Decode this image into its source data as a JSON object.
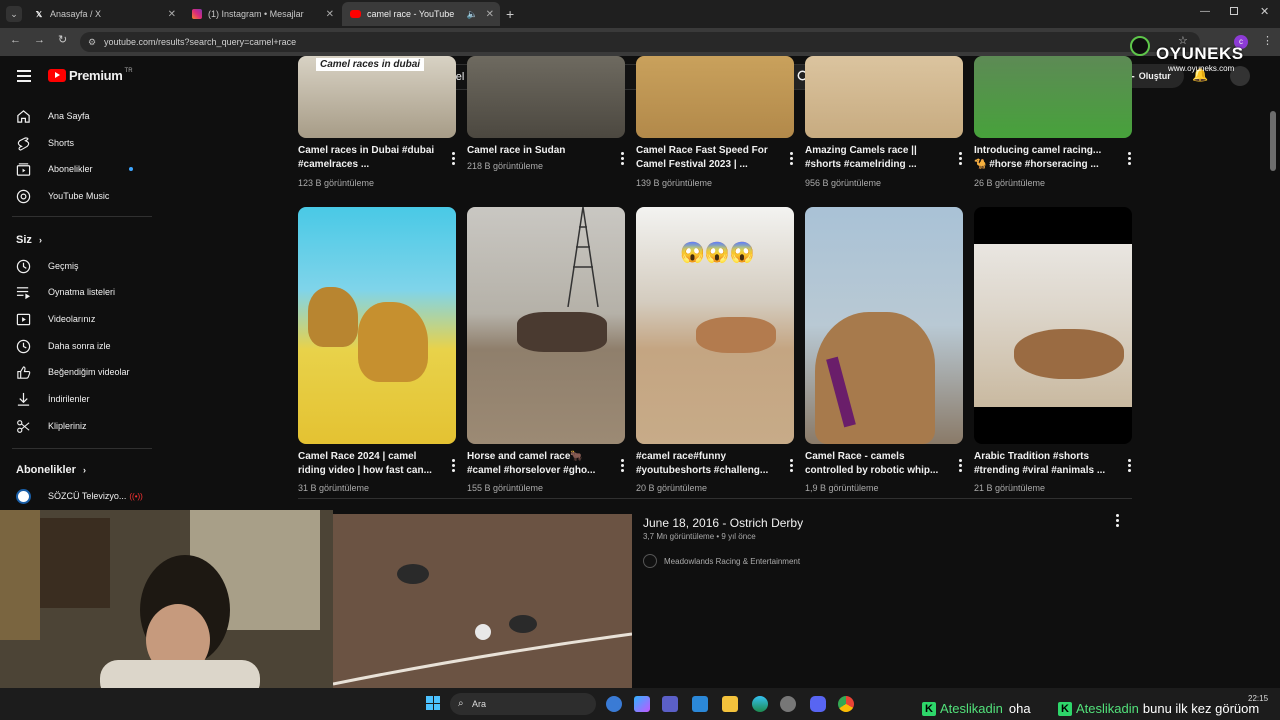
{
  "browser": {
    "tabs": [
      {
        "label": "Anasayfa / X"
      },
      {
        "label": "(1) Instagram • Mesajlar"
      },
      {
        "label": "camel race - YouTube"
      }
    ],
    "url": "youtube.com/results?search_query=camel+race"
  },
  "youtube": {
    "logo_label": "Premium",
    "logo_sup": "TR",
    "search_value": "camel race",
    "create_label": "Oluştur",
    "sidebar": {
      "main": [
        "Ana Sayfa",
        "Shorts",
        "Abonelikler",
        "YouTube Music"
      ],
      "you_header": "Siz",
      "you_items": [
        "Geçmiş",
        "Oynatma listeleri",
        "Videolarınız",
        "Daha sonra izle",
        "Beğendiğim videolar",
        "İndirilenler",
        "Klipleriniz"
      ],
      "subs_header": "Abonelikler",
      "subs_items": [
        "SÖZCÜ Televizyo..."
      ]
    },
    "row1": [
      {
        "title": "Camel races in Dubai #dubai #camelraces ...",
        "views": "123 B görüntüleme",
        "overlay": "Camel races in dubai"
      },
      {
        "title": "Camel race in Sudan",
        "views": "218 B görüntüleme"
      },
      {
        "title": "Camel Race Fast Speed  For Camel Festival 2023 | ...",
        "views": "139 B görüntüleme"
      },
      {
        "title": "Amazing Camels race || #shorts #camelriding ...",
        "views": "956 B görüntüleme"
      },
      {
        "title": "Introducing camel racing... 🐪 #horse #horseracing ...",
        "views": "26 B görüntüleme"
      }
    ],
    "row2": [
      {
        "title": "Camel Race 2024 | camel riding video | how fast can...",
        "views": "31 B görüntüleme"
      },
      {
        "title": "Horse and camel race🐂 #camel #horselover #gho...",
        "views": "155 B görüntüleme"
      },
      {
        "title": "#camel race#funny #youtubeshorts #challeng...",
        "views": "20 B görüntüleme",
        "overlay": "😱😱😱"
      },
      {
        "title": "Camel Race - camels controlled by robotic whip...",
        "views": "1,9 B görüntüleme"
      },
      {
        "title": "Arabic Tradition #shorts #trending #viral #animals ...",
        "views": "21 B görüntüleme"
      }
    ],
    "video": {
      "title": "June 18, 2016 - Ostrich Derby",
      "meta": "3,7 Mn görüntüleme • 9 yıl önce",
      "channel": "Meadowlands Racing & Entertainment"
    }
  },
  "overlay_brand": {
    "name": "OYUNEKS",
    "site": "www.oyuneks.com"
  },
  "taskbar": {
    "search_label": "Ara",
    "time": "22:15"
  },
  "chat": [
    {
      "user": "Ateslikadin",
      "msg": "oha"
    },
    {
      "user": "Ateslikadin",
      "msg": "bunu ilk kez görüom"
    }
  ]
}
